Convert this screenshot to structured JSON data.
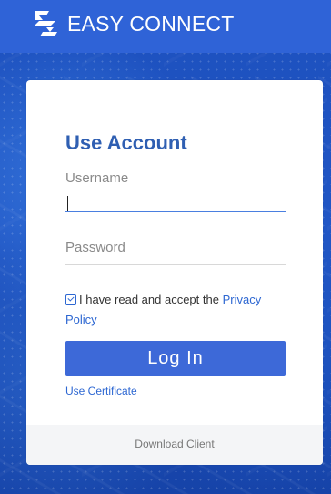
{
  "brand": {
    "name": "EASY CONNECT",
    "icon": "easy-connect-logo-icon"
  },
  "login_card": {
    "title": "Use Account",
    "username": {
      "label": "Username",
      "value": ""
    },
    "password": {
      "label": "Password",
      "value": ""
    },
    "agreement": {
      "checked": true,
      "text": "I have read and accept the",
      "link_text": "Privacy Policy"
    },
    "login_button": "Log In",
    "use_certificate": "Use Certificate",
    "footer_link": "Download Client"
  },
  "colors": {
    "brand_blue": "#2f63d7",
    "accent_blue": "#2d67d2",
    "button_blue": "#3d69d8",
    "background_blue": "#1b4fb8",
    "card_white": "#ffffff",
    "footer_gray": "#f4f5f7"
  }
}
